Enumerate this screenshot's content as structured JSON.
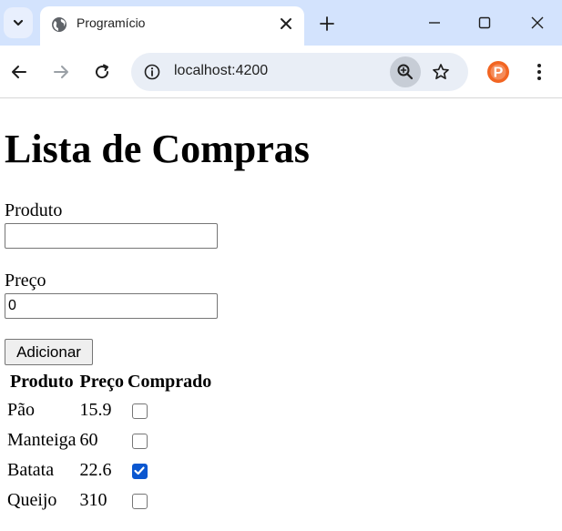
{
  "browser": {
    "tab_title": "Programício",
    "url": "localhost:4200",
    "icons": {
      "tab_search": "chevron-down-icon",
      "favicon": "globe-icon",
      "tab_close": "close-icon",
      "new_tab": "plus-icon",
      "minimize": "minimize-icon",
      "maximize": "maximize-icon",
      "close_window": "close-icon",
      "back": "back-arrow-icon",
      "forward": "forward-arrow-icon",
      "reload": "reload-icon",
      "site_info": "info-icon",
      "zoom": "zoom-in-icon",
      "bookmark": "star-icon",
      "extension": "extension-p-icon",
      "menu": "kebab-menu-icon"
    },
    "extension_letter": "P",
    "colors": {
      "tabstrip": "#d3e3fd",
      "omnibox": "#e9eef6",
      "extension": "#f26522"
    }
  },
  "page": {
    "title": "Lista de Compras",
    "form": {
      "produto_label": "Produto",
      "produto_value": "",
      "preco_label": "Preço",
      "preco_value": "0",
      "submit_label": "Adicionar"
    },
    "table": {
      "headers": [
        "Produto",
        "Preço",
        "Comprado"
      ],
      "rows": [
        {
          "produto": "Pão",
          "preco": "15.9",
          "comprado": false
        },
        {
          "produto": "Manteiga",
          "preco": "60",
          "comprado": false
        },
        {
          "produto": "Batata",
          "preco": "22.6",
          "comprado": true
        },
        {
          "produto": "Queijo",
          "preco": "310",
          "comprado": false
        }
      ]
    }
  }
}
